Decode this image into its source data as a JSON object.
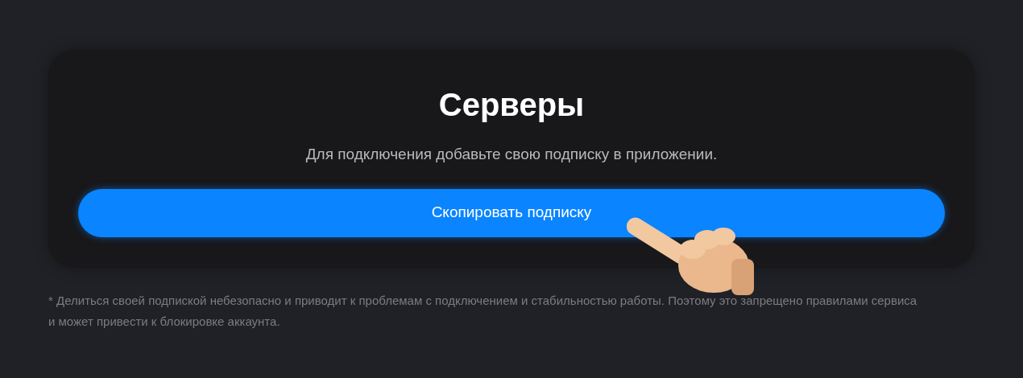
{
  "card": {
    "title": "Серверы",
    "description": "Для подключения добавьте свою подписку в приложении.",
    "button": "Скопировать подписку"
  },
  "footnote": "* Делиться своей подпиской небезопасно и приводит к проблемам с подключением и стабильностью работы. Поэтому это запрещено правилами сервиса и может привести к блокировке аккаунта."
}
